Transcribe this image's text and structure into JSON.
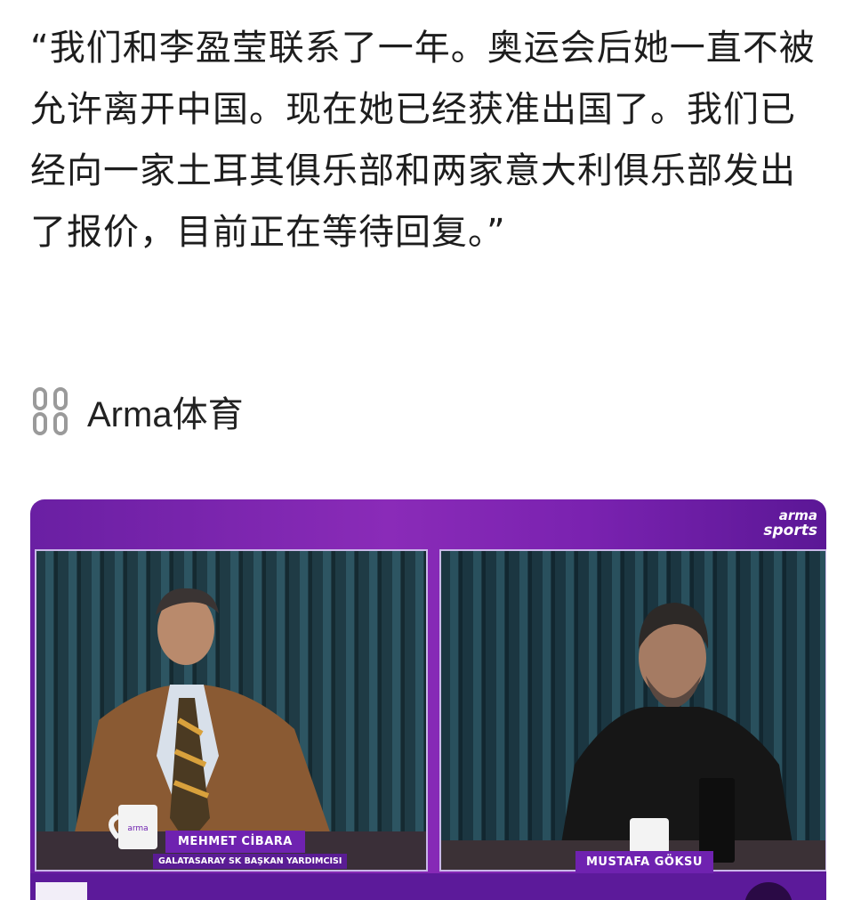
{
  "post": {
    "quote_text": "“我们和李盈莹联系了一年。奥运会后她一直不被允许离开中国。现在她已经获准出国了。我们已经向一家土耳其俱乐部和两家意大利俱乐部发出了报价，目前正在等待回复。”",
    "source_icon": "link-chain-icon",
    "source_label": "Arma体育"
  },
  "video": {
    "logo_line1": "arma",
    "logo_line2": "sports",
    "left_speaker_name": "MEHMET CİBARA",
    "left_speaker_title": "GALATASARAY SK BAŞKAN YARDIMCISI",
    "right_speaker_name": "MUSTAFA GÖKSU",
    "colors": {
      "accent": "#7a22b0",
      "tag": "#6f22b0"
    }
  }
}
